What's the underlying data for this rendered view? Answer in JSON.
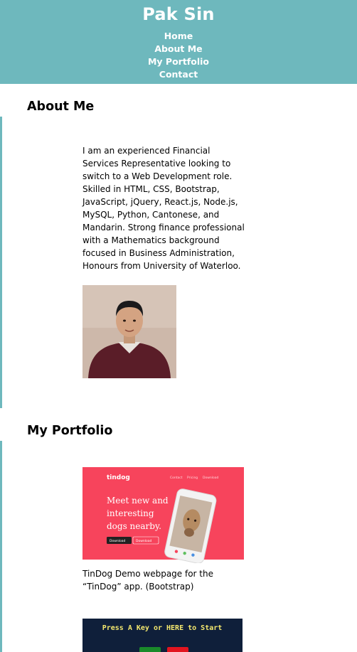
{
  "header": {
    "title": "Pak Sin",
    "nav": [
      "Home",
      "About Me",
      "My Portfolio",
      "Contact"
    ]
  },
  "about": {
    "heading": "About Me",
    "paragraph": "I am an experienced Financial Services Representative looking to switch to a Web Development role. Skilled in HTML, CSS, Bootstrap, JavaScript, jQuery, React.js, Node.js, MySQL, Python, Cantonese, and Mandarin. Strong finance professional with a Mathematics background focused in Business Administration, Honours from University of Waterloo."
  },
  "portfolio": {
    "heading": "My Portfolio",
    "items": [
      {
        "thumb": {
          "brand": "tindog",
          "nav": [
            "Contact",
            "Pricing",
            "Download"
          ],
          "headline": [
            "Meet new and",
            "interesting",
            "dogs nearby."
          ],
          "btn1": "Download",
          "btn2": "Download"
        },
        "caption": "TinDog Demo webpage for the “TinDog” app. (Bootstrap)"
      },
      {
        "thumb": {
          "text": "Press A Key or HERE to Start"
        },
        "caption": ""
      }
    ]
  },
  "colors": {
    "accent": "#6eb8bd",
    "tindog_bg": "#f7445c",
    "game_bg": "#0f1f3a",
    "game_text": "#f4e86e"
  }
}
